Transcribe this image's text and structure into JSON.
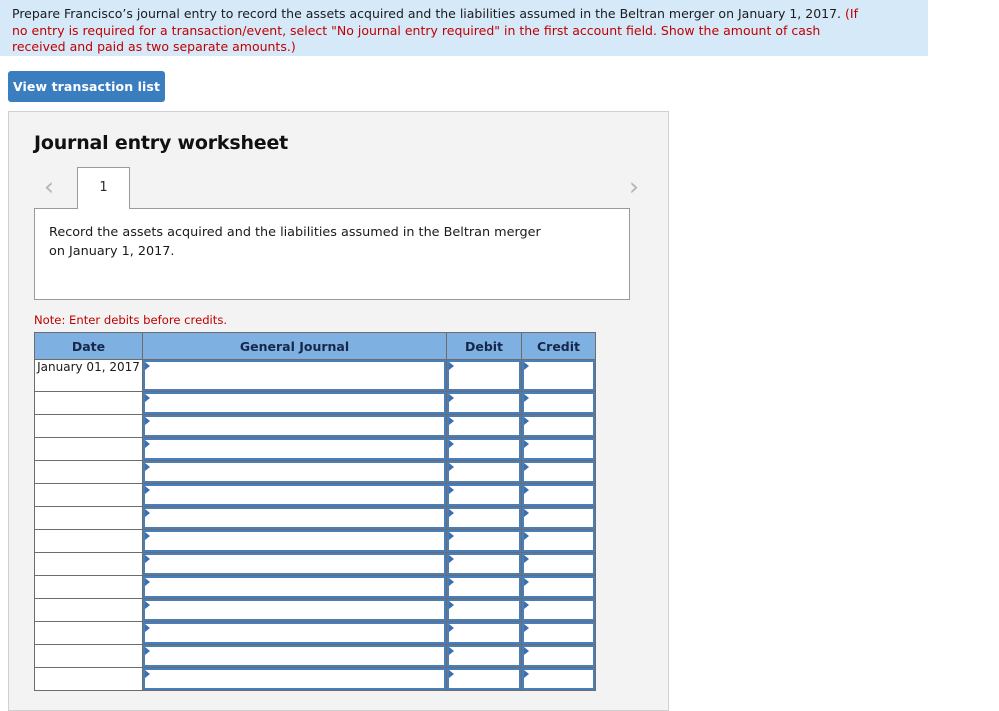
{
  "instruction": {
    "main": "Prepare Francisco’s journal entry to record the assets acquired and the liabilities assumed in the Beltran merger on January 1, 2017.",
    "hint_1": "(If",
    "hint_2": "no entry is required for a transaction/event, select \"No journal entry required\" in the first account field. Show the amount of cash",
    "hint_3": "received and paid as two separate amounts.)",
    "banner_color": "#d6e9f8",
    "hint_color": "#c00000"
  },
  "toolbar": {
    "view_transaction_list_label": "View transaction list",
    "button_color": "#3a7ebf"
  },
  "worksheet": {
    "title": "Journal entry worksheet",
    "prev_label": "‹",
    "next_label": "›",
    "tabs": [
      {
        "label": "1",
        "active": true
      }
    ],
    "description_line_1": "Record the assets acquired and the liabilities assumed in the Beltran merger",
    "description_line_2": "on January 1, 2017.",
    "note": "Note: Enter debits before credits."
  },
  "journal_table": {
    "header_color": "#7fb0e2",
    "field_border_color": "#4a7ebb",
    "columns": [
      "Date",
      "General Journal",
      "Debit",
      "Credit"
    ],
    "rows": [
      {
        "date": "January 01, 2017",
        "general_journal": "",
        "debit": "",
        "credit": ""
      },
      {
        "date": "",
        "general_journal": "",
        "debit": "",
        "credit": ""
      },
      {
        "date": "",
        "general_journal": "",
        "debit": "",
        "credit": ""
      },
      {
        "date": "",
        "general_journal": "",
        "debit": "",
        "credit": ""
      },
      {
        "date": "",
        "general_journal": "",
        "debit": "",
        "credit": ""
      },
      {
        "date": "",
        "general_journal": "",
        "debit": "",
        "credit": ""
      },
      {
        "date": "",
        "general_journal": "",
        "debit": "",
        "credit": ""
      },
      {
        "date": "",
        "general_journal": "",
        "debit": "",
        "credit": ""
      },
      {
        "date": "",
        "general_journal": "",
        "debit": "",
        "credit": ""
      },
      {
        "date": "",
        "general_journal": "",
        "debit": "",
        "credit": ""
      },
      {
        "date": "",
        "general_journal": "",
        "debit": "",
        "credit": ""
      },
      {
        "date": "",
        "general_journal": "",
        "debit": "",
        "credit": ""
      },
      {
        "date": "",
        "general_journal": "",
        "debit": "",
        "credit": ""
      },
      {
        "date": "",
        "general_journal": "",
        "debit": "",
        "credit": ""
      }
    ]
  }
}
